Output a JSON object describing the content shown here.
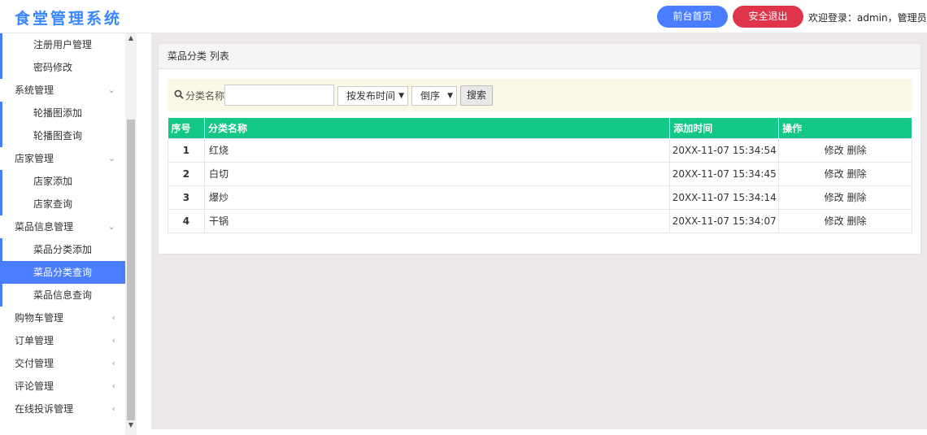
{
  "header": {
    "title": "食堂管理系统",
    "home_button": "前台首页",
    "logout_button": "安全退出",
    "welcome": "欢迎登录：admin，管理员"
  },
  "sidebar": {
    "items": [
      {
        "label": "注册用户管理",
        "type": "child",
        "active": false
      },
      {
        "label": "密码修改",
        "type": "child",
        "active": false
      },
      {
        "label": "系统管理",
        "type": "parent",
        "arrow": "chevron-down-icon"
      },
      {
        "label": "轮播图添加",
        "type": "child",
        "active": false
      },
      {
        "label": "轮播图查询",
        "type": "child",
        "active": false
      },
      {
        "label": "店家管理",
        "type": "parent",
        "arrow": "chevron-down-icon"
      },
      {
        "label": "店家添加",
        "type": "child",
        "active": false
      },
      {
        "label": "店家查询",
        "type": "child",
        "active": false
      },
      {
        "label": "菜品信息管理",
        "type": "parent",
        "arrow": "chevron-down-icon"
      },
      {
        "label": "菜品分类添加",
        "type": "child",
        "active": false
      },
      {
        "label": "菜品分类查询",
        "type": "child",
        "active": true
      },
      {
        "label": "菜品信息查询",
        "type": "child",
        "active": false
      },
      {
        "label": "购物车管理",
        "type": "parent",
        "arrow": "chevron-left-icon"
      },
      {
        "label": "订单管理",
        "type": "parent",
        "arrow": "chevron-left-icon"
      },
      {
        "label": "交付管理",
        "type": "parent",
        "arrow": "chevron-left-icon"
      },
      {
        "label": "评论管理",
        "type": "parent",
        "arrow": "chevron-left-icon"
      },
      {
        "label": "在线投诉管理",
        "type": "parent",
        "arrow": "chevron-left-icon"
      }
    ]
  },
  "panel": {
    "title": "菜品分类 列表"
  },
  "search": {
    "label": "分类名称",
    "input_value": "",
    "sort_field": "按发布时间",
    "sort_order": "倒序",
    "button": "搜索"
  },
  "table": {
    "headers": [
      "序号",
      "分类名称",
      "添加时间",
      "操作"
    ],
    "rows": [
      {
        "no": "1",
        "name": "红烧",
        "time": "20XX-11-07 15:34:54",
        "edit": "修改",
        "delete": "删除"
      },
      {
        "no": "2",
        "name": "白切",
        "time": "20XX-11-07 15:34:45",
        "edit": "修改",
        "delete": "删除"
      },
      {
        "no": "3",
        "name": "爆炒",
        "time": "20XX-11-07 15:34:14",
        "edit": "修改",
        "delete": "删除"
      },
      {
        "no": "4",
        "name": "干锅",
        "time": "20XX-11-07 15:34:07",
        "edit": "修改",
        "delete": "删除"
      }
    ]
  },
  "colors": {
    "brand": "#3a86ff",
    "accent": "#4a7dff",
    "danger": "#e0344b",
    "table_header": "#13c786",
    "search_bg": "#fcf8e7"
  }
}
